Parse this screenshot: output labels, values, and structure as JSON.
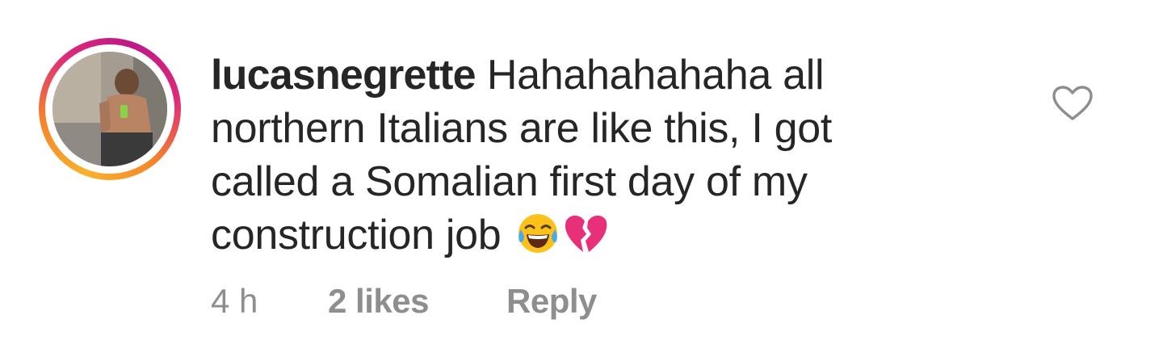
{
  "comment": {
    "username": "lucasnegrette",
    "lines": [
      " Hahahahahaha all",
      "northern Italians are like this, I got",
      "called a Somalian first day of my",
      "construction job"
    ],
    "emojis": [
      "face-with-tears-of-joy",
      "broken-heart"
    ],
    "timestamp": "4 h",
    "likes_label": "2 likes",
    "reply_label": "Reply",
    "liked": false
  },
  "colors": {
    "text": "#262626",
    "meta": "#8e8e8e",
    "heart_outline": "#8e8e8e",
    "story_ring": [
      "#f7b22e",
      "#f58529",
      "#dd2a7b",
      "#bc1888"
    ]
  }
}
